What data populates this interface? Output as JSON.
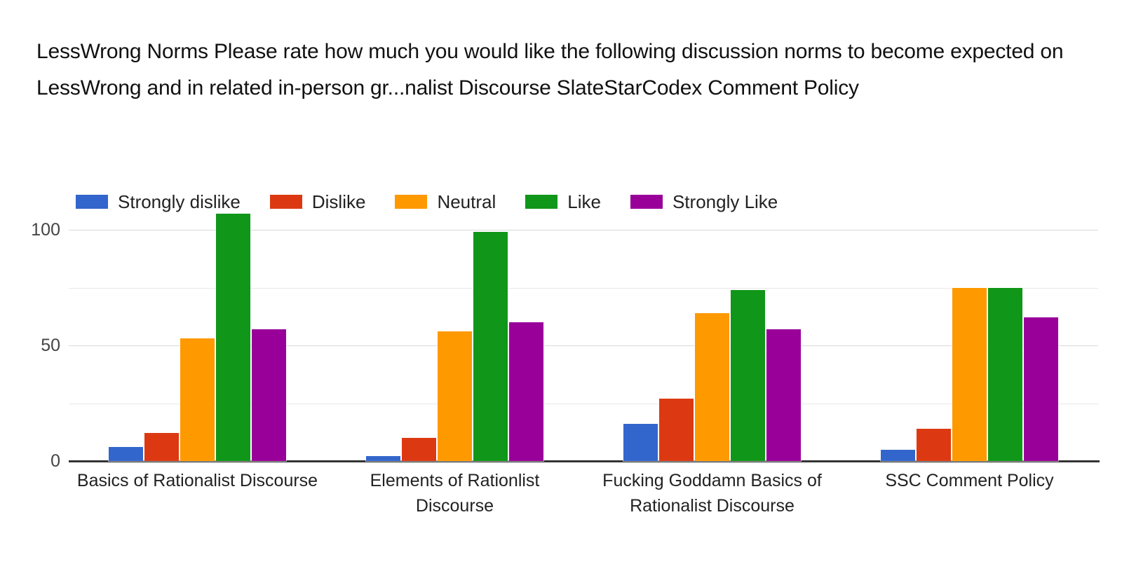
{
  "chart_data": {
    "type": "bar",
    "title": "LessWrong Norms Please rate how much you would like the following discussion norms to become expected on LessWrong and in related in-person gr...nalist Discourse SlateStarCodex Comment Policy",
    "xlabel": "",
    "ylabel": "",
    "ylim": [
      0,
      115
    ],
    "yticks": [
      0,
      50,
      100
    ],
    "ytick_labels": [
      "0",
      "50",
      "100"
    ],
    "minor_gridlines": [
      25,
      75
    ],
    "grid": true,
    "legend_position": "top-left",
    "grouped": true,
    "categories": [
      "Basics of Rationalist Discourse",
      "Elements of Rationlist Discourse",
      "Fucking Goddamn Basics of Rationalist Discourse",
      "SSC Comment Policy"
    ],
    "series": [
      {
        "name": "Strongly dislike",
        "color": "#3366cc",
        "values": [
          6,
          2,
          16,
          5
        ]
      },
      {
        "name": "Dislike",
        "color": "#dc3912",
        "values": [
          12,
          10,
          27,
          14
        ]
      },
      {
        "name": "Neutral",
        "color": "#ff9900",
        "values": [
          53,
          56,
          64,
          75
        ]
      },
      {
        "name": "Like",
        "color": "#109618",
        "values": [
          107,
          99,
          74,
          75
        ]
      },
      {
        "name": "Strongly Like",
        "color": "#990099",
        "values": [
          57,
          60,
          57,
          62
        ]
      }
    ]
  },
  "axis": {
    "tick_0": "0",
    "tick_50": "50",
    "tick_100": "100"
  },
  "legend": {
    "items": [
      {
        "label": "Strongly dislike",
        "color": "#3366cc"
      },
      {
        "label": "Dislike",
        "color": "#dc3912"
      },
      {
        "label": "Neutral",
        "color": "#ff9900"
      },
      {
        "label": "Like",
        "color": "#109618"
      },
      {
        "label": "Strongly Like",
        "color": "#990099"
      }
    ]
  }
}
